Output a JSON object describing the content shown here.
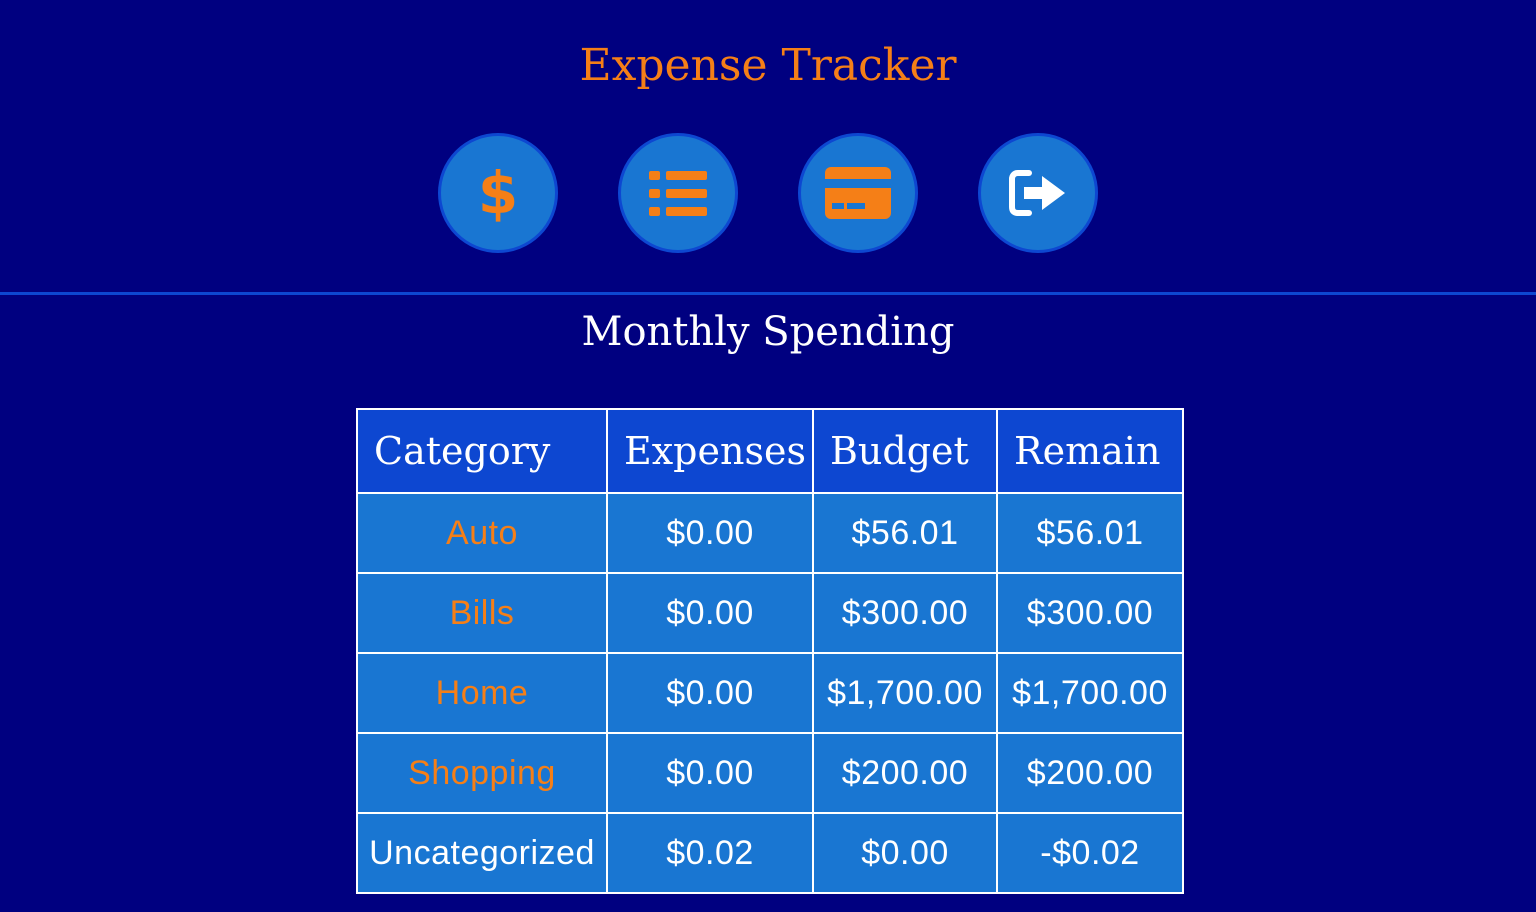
{
  "app": {
    "title": "Expense Tracker"
  },
  "nav": {
    "buttons": [
      {
        "icon": "dollar-icon"
      },
      {
        "icon": "list-icon"
      },
      {
        "icon": "credit-card-icon"
      },
      {
        "icon": "sign-out-icon"
      }
    ]
  },
  "section": {
    "title": "Monthly Spending"
  },
  "table": {
    "headers": [
      "Category",
      "Expenses",
      "Budget",
      "Remain"
    ],
    "rows": [
      {
        "category": "Auto",
        "expenses": "$0.00",
        "budget": "$56.01",
        "remain": "$56.01"
      },
      {
        "category": "Bills",
        "expenses": "$0.00",
        "budget": "$300.00",
        "remain": "$300.00"
      },
      {
        "category": "Home",
        "expenses": "$0.00",
        "budget": "$1,700.00",
        "remain": "$1,700.00"
      },
      {
        "category": "Shopping",
        "expenses": "$0.00",
        "budget": "$200.00",
        "remain": "$200.00"
      },
      {
        "category": "Uncategorized",
        "expenses": "$0.02",
        "budget": "$0.00",
        "remain": "-$0.02"
      }
    ]
  },
  "colors": {
    "background": "#000080",
    "accent": "#f57f17",
    "button": "#1976d2",
    "header_cell": "#0d47d1"
  }
}
